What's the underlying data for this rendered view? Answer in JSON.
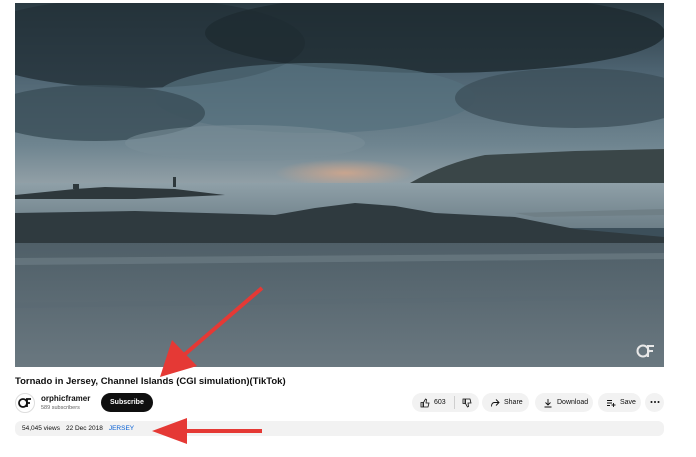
{
  "video": {
    "title": "Tornado in Jersey, Channel Islands (CGI simulation)(TikTok)",
    "watermark_icon": "channel-logo-watermark-icon"
  },
  "channel": {
    "name": "orphicframer",
    "subscribers": "589 subscribers",
    "subscribe_label": "Subscribe"
  },
  "actions": {
    "like_count": "603",
    "share_label": "Share",
    "download_label": "Download",
    "save_label": "Save",
    "icons": [
      "thumbs-up-icon",
      "thumbs-down-icon",
      "share-icon",
      "download-icon",
      "save-playlist-icon",
      "more-icon"
    ]
  },
  "description": {
    "views": "54,045 views",
    "date": "22 Dec 2018",
    "hashtag": "JERSEY"
  },
  "annotations": {
    "arrow_color": "#e53935"
  }
}
